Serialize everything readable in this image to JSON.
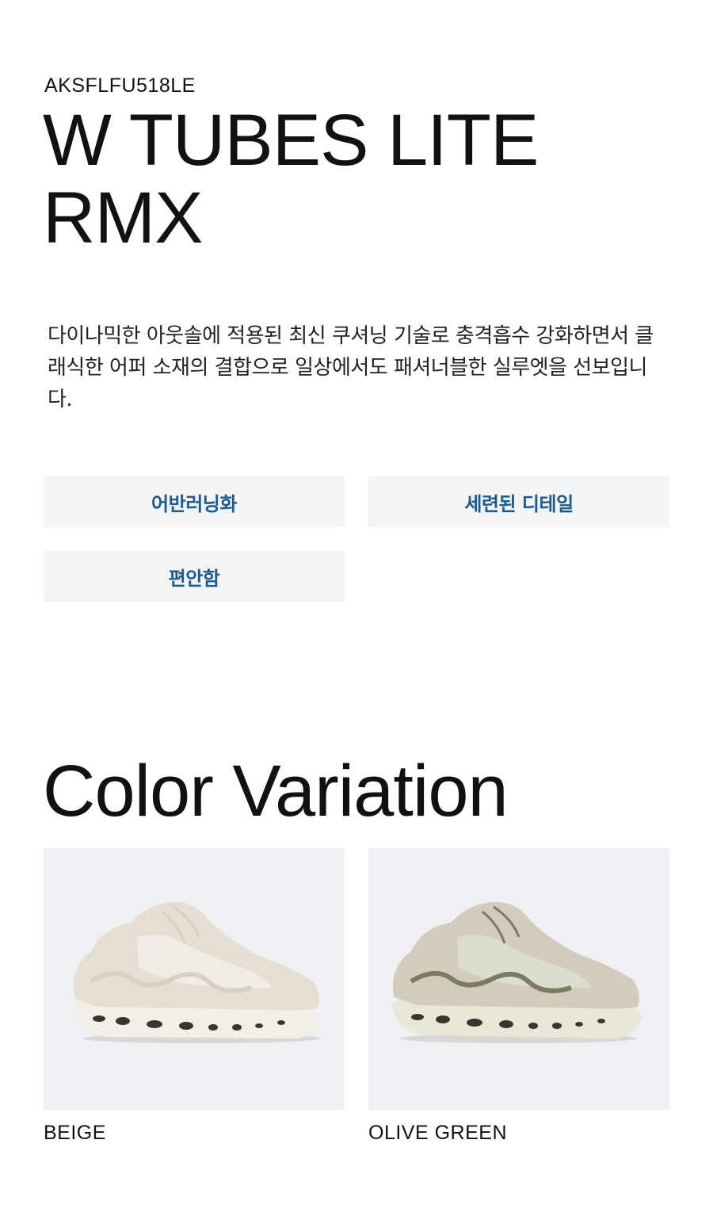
{
  "product": {
    "sku": "AKSFLFU518LE",
    "title": "W TUBES LITE RMX",
    "description": "다이나믹한 아웃솔에 적용된 최신 쿠셔닝 기술로 충격흡수 강화하면서 클래식한 어퍼 소재의 결합으로 일상에서도 패셔너블한 실루엣을 선보입니다."
  },
  "tags": [
    {
      "label": "어반러닝화"
    },
    {
      "label": "세련된 디테일"
    },
    {
      "label": "편안함"
    }
  ],
  "colors": {
    "heading": "Color Variation",
    "items": [
      {
        "name": "BEIGE",
        "icon": "sneaker-beige-image",
        "upper": "#e6ded2",
        "mesh": "#f1ece6",
        "sole": "#f3efe6",
        "accent": "#d9cfc2"
      },
      {
        "name": "OLIVE GREEN",
        "icon": "sneaker-olive-image",
        "upper": "#d3ccbd",
        "mesh": "#dcdccf",
        "sole": "#e8e7d8",
        "accent": "#7a7b63"
      }
    ]
  },
  "theme": {
    "tag_background": "#f3f4f6",
    "tag_text": "#1d5b8e",
    "image_background": "#eff0f4"
  }
}
